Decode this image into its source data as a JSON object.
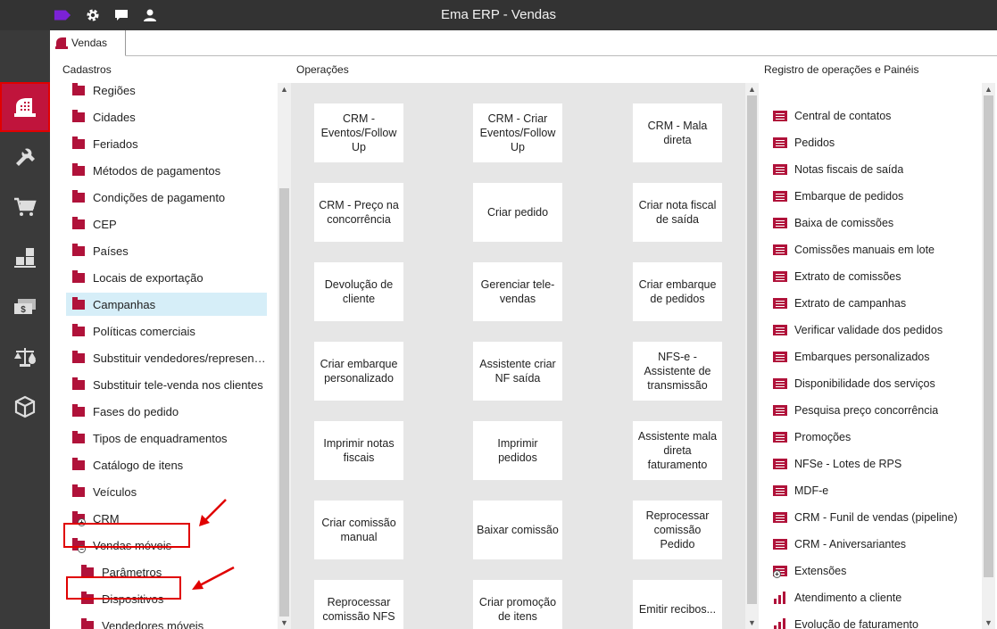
{
  "window": {
    "title": "Ema ERP - Vendas"
  },
  "top_icons": [
    "tag-icon",
    "gear-icon",
    "chat-icon",
    "user-icon"
  ],
  "sidebar": {
    "items": [
      {
        "name": "sidebar-item-vendas",
        "icon": "cash-register-icon",
        "active": true
      },
      {
        "name": "sidebar-item-tools",
        "icon": "tools-icon",
        "active": false
      },
      {
        "name": "sidebar-item-cart",
        "icon": "cart-icon",
        "active": false
      },
      {
        "name": "sidebar-item-inventory",
        "icon": "boxes-icon",
        "active": false
      },
      {
        "name": "sidebar-item-finance",
        "icon": "money-icon",
        "active": false
      },
      {
        "name": "sidebar-item-accounting",
        "icon": "scale-icon",
        "active": false
      },
      {
        "name": "sidebar-item-packages",
        "icon": "package-icon",
        "active": false
      }
    ]
  },
  "tabs": [
    {
      "label": "Vendas"
    }
  ],
  "sections": {
    "cadastros": "Cadastros",
    "operacoes": "Operações",
    "registro": "Registro de operações e Painéis"
  },
  "cadastros": {
    "items": [
      {
        "label": "Regiões",
        "level": 0,
        "expander": ""
      },
      {
        "label": "Cidades",
        "level": 0,
        "expander": ""
      },
      {
        "label": "Feriados",
        "level": 0,
        "expander": ""
      },
      {
        "label": "Métodos de pagamentos",
        "level": 0,
        "expander": ""
      },
      {
        "label": "Condições de pagamento",
        "level": 0,
        "expander": ""
      },
      {
        "label": "CEP",
        "level": 0,
        "expander": ""
      },
      {
        "label": "Países",
        "level": 0,
        "expander": ""
      },
      {
        "label": "Locais de exportação",
        "level": 0,
        "expander": ""
      },
      {
        "label": "Campanhas",
        "level": 0,
        "expander": "",
        "selected": true
      },
      {
        "label": "Políticas comerciais",
        "level": 0,
        "expander": ""
      },
      {
        "label": "Substituir vendedores/representantes",
        "level": 0,
        "expander": ""
      },
      {
        "label": "Substituir tele-venda nos clientes",
        "level": 0,
        "expander": ""
      },
      {
        "label": "Fases do pedido",
        "level": 0,
        "expander": ""
      },
      {
        "label": "Tipos de enquadramentos",
        "level": 0,
        "expander": ""
      },
      {
        "label": "Catálogo de itens",
        "level": 0,
        "expander": ""
      },
      {
        "label": "Veículos",
        "level": 0,
        "expander": ""
      },
      {
        "label": "CRM",
        "level": 0,
        "expander": "+"
      },
      {
        "label": "Vendas móveis",
        "level": 0,
        "expander": "−"
      },
      {
        "label": "Parâmetros",
        "level": 1,
        "expander": ""
      },
      {
        "label": "Dispositivos",
        "level": 1,
        "expander": ""
      },
      {
        "label": "Vendedores móveis",
        "level": 1,
        "expander": ""
      }
    ]
  },
  "operacoes": {
    "tiles": [
      "CRM - Eventos/Follow Up",
      "CRM - Criar Eventos/Follow Up",
      "CRM - Mala direta",
      "CRM - Preço na concorrência",
      "Criar pedido",
      "Criar nota fiscal de saída",
      "Devolução de cliente",
      "Gerenciar tele-vendas",
      "Criar embarque de pedidos",
      "Criar embarque personalizado",
      "Assistente criar NF saída",
      "NFS-e - Assistente de transmissão",
      "Imprimir notas fiscais",
      "Imprimir pedidos",
      "Assistente mala direta faturamento",
      "Criar comissão manual",
      "Baixar comissão",
      "Reprocessar comissão Pedido",
      "Reprocessar comissão NFS",
      "Criar promoção de itens",
      "Emitir recibos..."
    ]
  },
  "registro": {
    "items": [
      {
        "label": "Central de contatos",
        "icon": "list"
      },
      {
        "label": "Pedidos",
        "icon": "list"
      },
      {
        "label": "Notas fiscais de saída",
        "icon": "list"
      },
      {
        "label": "Embarque de pedidos",
        "icon": "list"
      },
      {
        "label": "Baixa de comissões",
        "icon": "list"
      },
      {
        "label": "Comissões manuais em lote",
        "icon": "list"
      },
      {
        "label": "Extrato de comissões",
        "icon": "list"
      },
      {
        "label": "Extrato de campanhas",
        "icon": "list"
      },
      {
        "label": "Verificar validade dos pedidos",
        "icon": "list"
      },
      {
        "label": "Embarques personalizados",
        "icon": "list"
      },
      {
        "label": "Disponibilidade dos serviços",
        "icon": "list"
      },
      {
        "label": "Pesquisa preço concorrência",
        "icon": "list"
      },
      {
        "label": "Promoções",
        "icon": "list"
      },
      {
        "label": "NFSe - Lotes de RPS",
        "icon": "list"
      },
      {
        "label": "MDF-e",
        "icon": "list"
      },
      {
        "label": "CRM - Funil de vendas (pipeline)",
        "icon": "list"
      },
      {
        "label": "CRM - Aniversariantes",
        "icon": "list"
      },
      {
        "label": "Extensões",
        "icon": "list-plus"
      },
      {
        "label": "Atendimento a cliente",
        "icon": "bars"
      },
      {
        "label": "Evolução de faturamento",
        "icon": "bars"
      }
    ]
  },
  "colors": {
    "accent": "#b0123a",
    "topbar": "#333333",
    "sidebar": "#3a3a3a",
    "selected": "#d6eef8",
    "annotation": "#e00000"
  }
}
